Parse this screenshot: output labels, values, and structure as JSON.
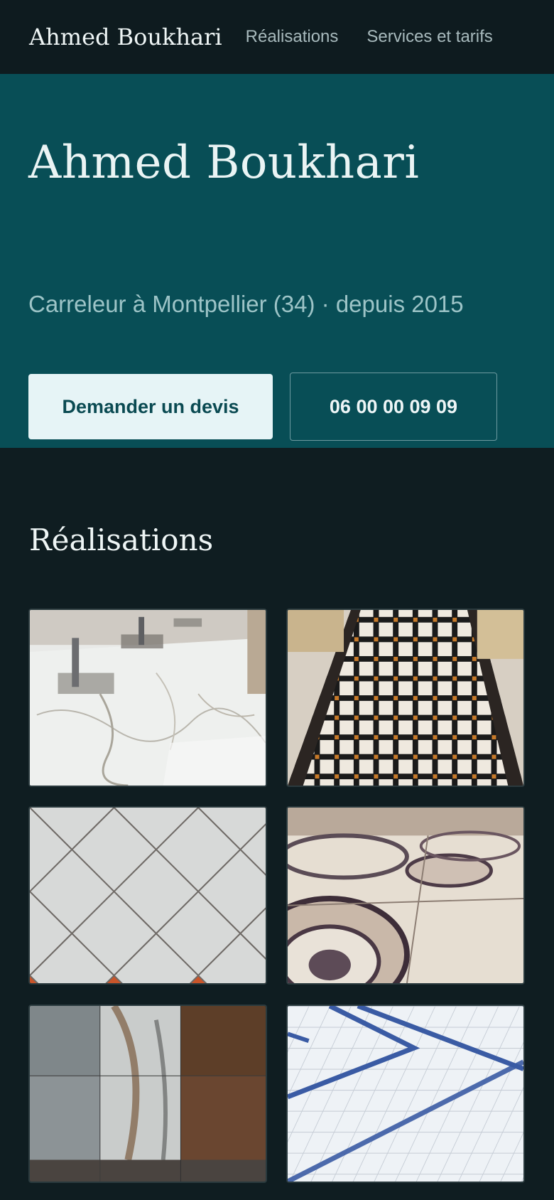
{
  "nav": {
    "brand": "Ahmed Boukhari",
    "links": [
      "Réalisations",
      "Services et tarifs"
    ]
  },
  "hero": {
    "title": "Ahmed Boukhari",
    "subtitle": "Carreleur à Montpellier (34) · depuis 2015",
    "cta_primary": "Demander un devis",
    "cta_phone": "06 00 00 09 09"
  },
  "gallery": {
    "title": "Réalisations",
    "photos": [
      {
        "subject": "white marble floor in salon"
      },
      {
        "subject": "black and orange mosaic corridor"
      },
      {
        "subject": "terracotta and grey diamond tiles"
      },
      {
        "subject": "ornate marble inlay medallions"
      },
      {
        "subject": "stone and wood-look tile samples"
      },
      {
        "subject": "white tiles with blue border stripes"
      }
    ]
  },
  "colors": {
    "nav_bg": "#0e1b1f",
    "hero_bg": "#084e56",
    "page_bg": "#0f1d21",
    "accent_light": "#e6f4f6"
  }
}
